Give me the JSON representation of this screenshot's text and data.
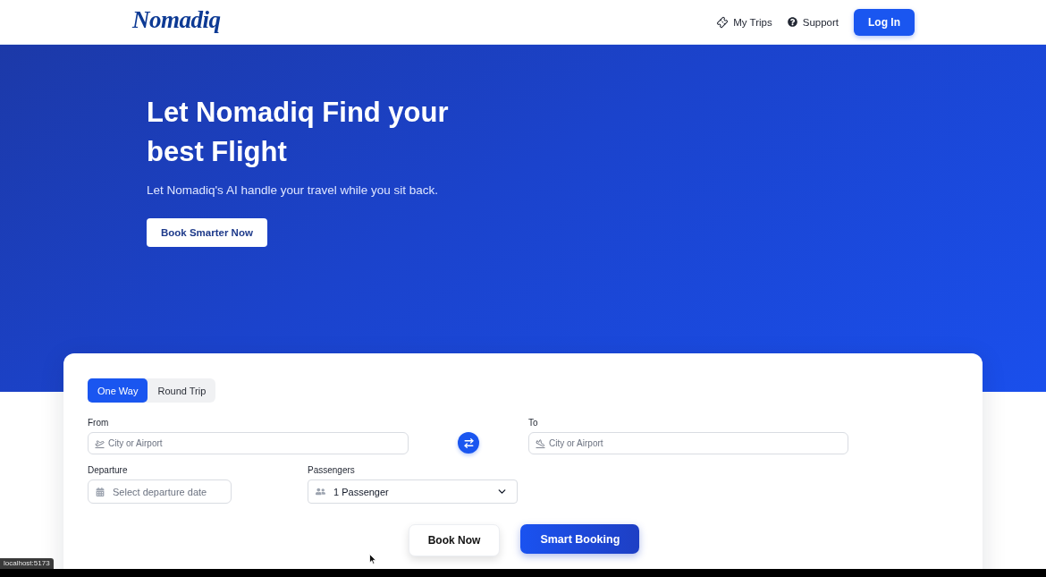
{
  "header": {
    "logo": "Nomadiq",
    "nav": [
      {
        "label": "My Trips"
      },
      {
        "label": "Support"
      }
    ],
    "login_button": "Log In"
  },
  "hero": {
    "title": "Let Nomadiq Find your best Flight",
    "subtitle": "Let Nomadiq's AI handle your travel while you sit back.",
    "cta": "Book Smarter Now"
  },
  "search": {
    "trip_types": [
      {
        "label": "One Way",
        "selected": true
      },
      {
        "label": "Round Trip",
        "selected": false
      }
    ],
    "from": {
      "label": "From",
      "placeholder": "City or Airport"
    },
    "to": {
      "label": "To",
      "placeholder": "City or Airport"
    },
    "departure": {
      "label": "Departure",
      "placeholder": "Select departure date"
    },
    "passengers": {
      "label": "Passengers",
      "value": "1 Passenger"
    },
    "buttons": [
      {
        "label": "Book Now",
        "kind": "secondary"
      },
      {
        "label": "Smart Booking",
        "kind": "primary"
      }
    ]
  },
  "status_tooltip": "localhost:5173"
}
